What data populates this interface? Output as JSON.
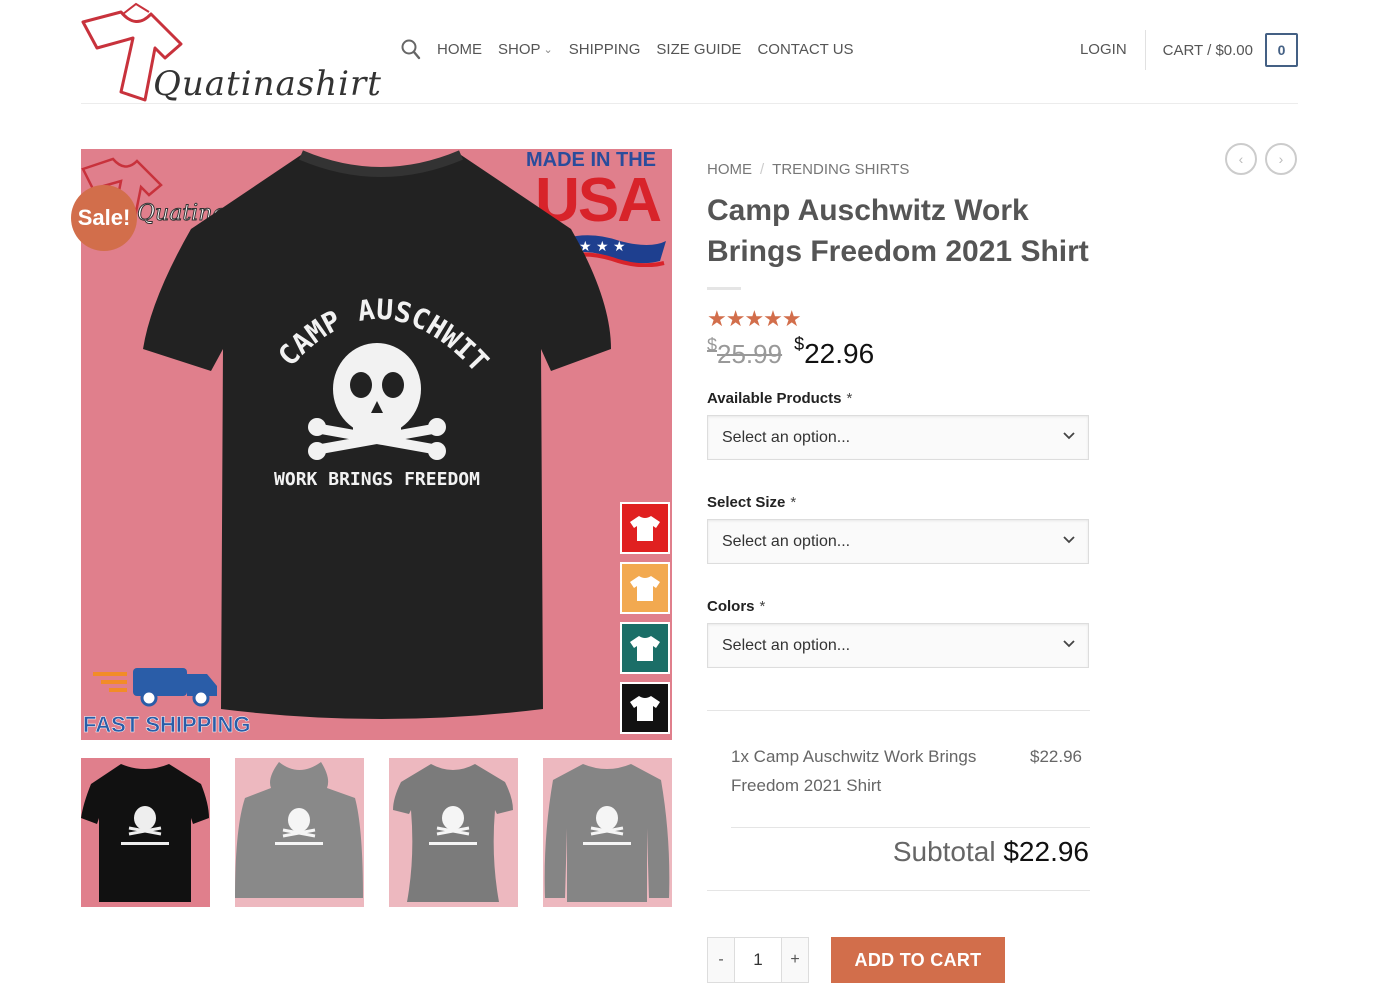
{
  "brand": {
    "logo_text": "Quatinashirt"
  },
  "nav": {
    "items": [
      "HOME",
      "SHOP",
      "SHIPPING",
      "SIZE GUIDE",
      "CONTACT US"
    ],
    "login": "LOGIN",
    "cart_label": "CART / $0.00",
    "cart_count": "0"
  },
  "product_image": {
    "sale_badge": "Sale!",
    "watermark": "Quatinashirt",
    "made_in": "MADE IN THE",
    "usa": "USA",
    "fast_shipping": "FAST SHIPPING",
    "shirt_text_top": "CAMP AUSCHWITZ",
    "shirt_text_bottom": "WORK BRINGS FREEDOM",
    "swatch_colors": [
      "#e02020",
      "#f2a950",
      "#1b6e67",
      "#111111"
    ]
  },
  "breadcrumb": {
    "home": "HOME",
    "separator": "/",
    "category": "TRENDING SHIRTS"
  },
  "product": {
    "title": "Camp Auschwitz Work Brings Freedom 2021 Shirt",
    "rating_stars": "★★★★★",
    "rating": 5,
    "currency": "$",
    "old_price": "25.99",
    "new_price": "22.96"
  },
  "options": {
    "available_products_label": "Available Products",
    "size_label": "Select Size",
    "colors_label": "Colors",
    "required_mark": "*",
    "placeholder": "Select an option..."
  },
  "summary": {
    "item": "1x Camp Auschwitz Work Brings Freedom 2021 Shirt",
    "item_price": "$22.96",
    "subtotal_label": "Subtotal",
    "subtotal_value": "$22.96"
  },
  "cart_controls": {
    "minus": "-",
    "quantity": "1",
    "plus": "+",
    "add_to_cart": "ADD TO CART"
  },
  "colors": {
    "accent": "#d26e4b",
    "cart_border": "#446084",
    "image_bg": "#e07f8c"
  }
}
